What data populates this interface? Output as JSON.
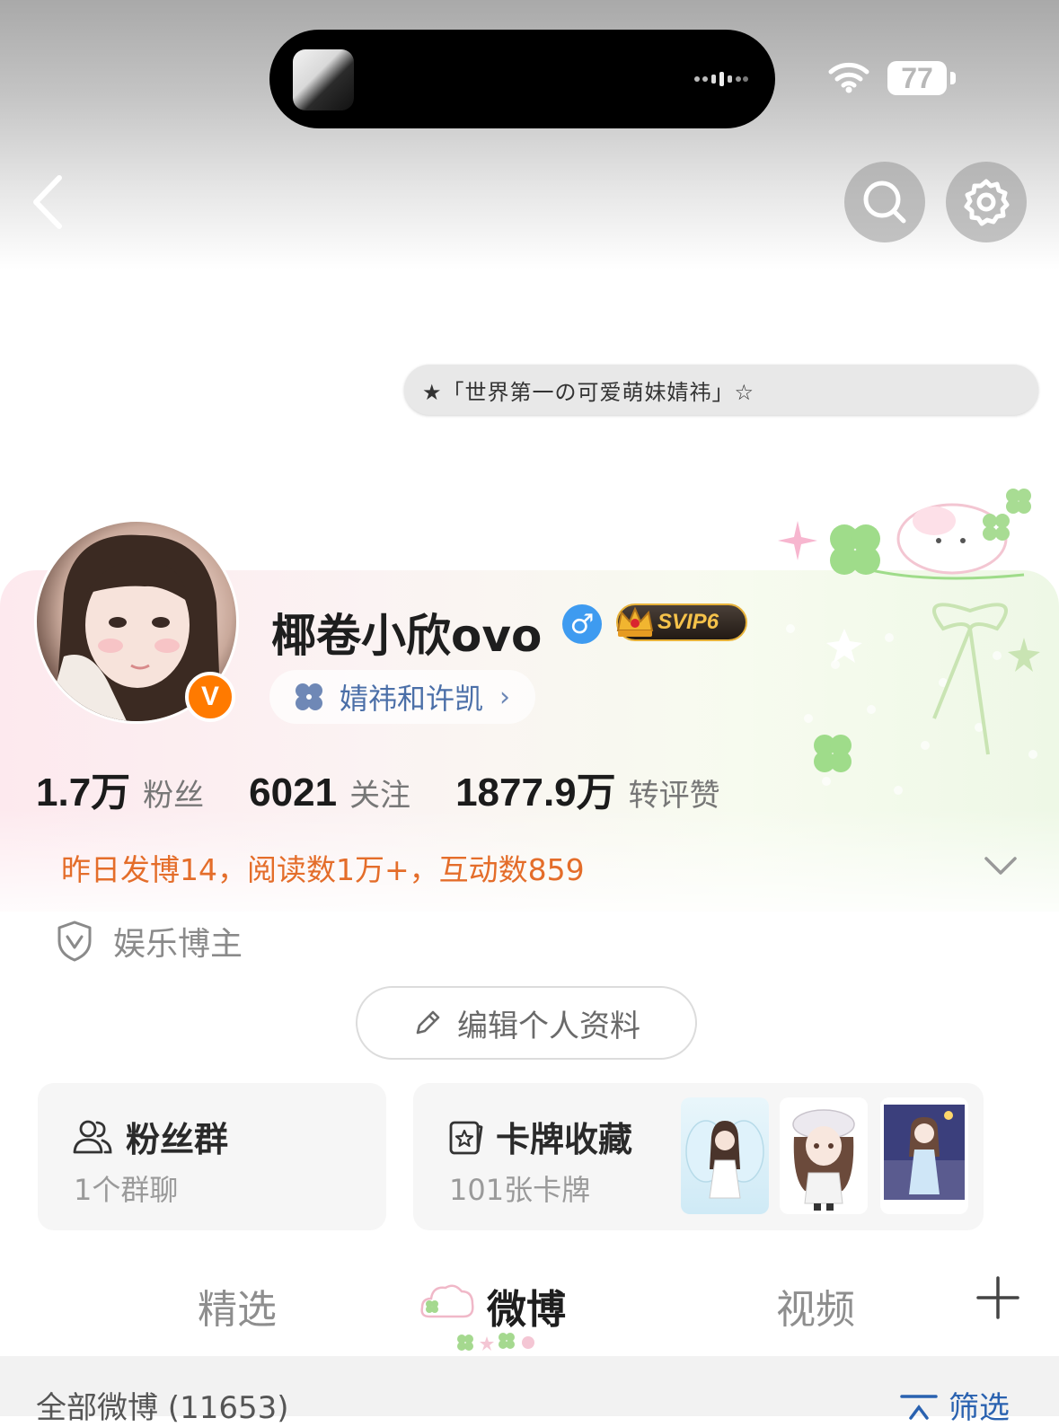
{
  "status_bar": {
    "battery": "77",
    "icons": [
      "wifi-icon",
      "battery-icon"
    ]
  },
  "header": {
    "back_icon": "chevron-left-icon",
    "search_icon": "search-icon",
    "settings_icon": "gear-icon"
  },
  "signature": "★「世界第一の可爱萌妹婧祎」☆",
  "profile": {
    "name": "椰卷小欣ovo",
    "gender_symbol": "♂",
    "vip_label": "SVIP6",
    "verified_badge": "V",
    "cp_tag": "婧祎和许凯",
    "cp_chevron": "›",
    "colors": {
      "accent_orange": "#ff7a00",
      "activity_text": "#e46d2a",
      "link_blue": "#2a62b0"
    }
  },
  "stats": [
    {
      "value": "1.7万",
      "label": "粉丝"
    },
    {
      "value": "6021",
      "label": "关注"
    },
    {
      "value": "1877.9万",
      "label": "转评赞"
    }
  ],
  "activity": "昨日发博14，阅读数1万+，互动数859",
  "verification": {
    "icon": "shield-v-icon",
    "label": "娱乐博主"
  },
  "edit_profile": {
    "icon": "pencil-icon",
    "label": "编辑个人资料"
  },
  "fans_group": {
    "icon": "people-icon",
    "title": "粉丝群",
    "subtitle": "1个群聊"
  },
  "card_collection": {
    "icon": "card-star-icon",
    "title": "卡牌收藏",
    "subtitle": "101张卡牌"
  },
  "tabs": [
    {
      "label": "精选"
    },
    {
      "label": "微博"
    },
    {
      "label": "视频"
    }
  ],
  "tab_add_icon": "plus-icon",
  "feed_header": {
    "title": "全部微博 (11653)",
    "filter_label": "筛选",
    "filter_icon": "filter-icon"
  }
}
